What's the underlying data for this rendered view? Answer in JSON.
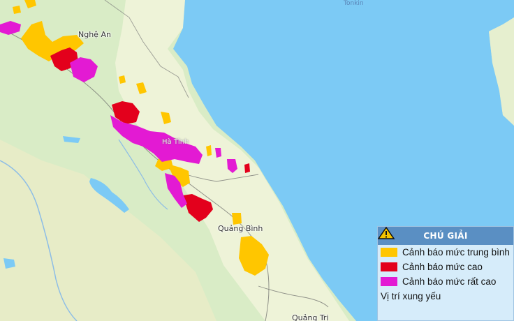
{
  "map": {
    "colors": {
      "sea": "#7ccaf5",
      "land": "#d9ecc6",
      "medium": "#ffc600",
      "high": "#e3001c",
      "very_high": "#e31ad3"
    },
    "places": {
      "nghe_an": "Nghệ An",
      "ha_tinh": "Hà Tĩnh",
      "quang_binh": "Quảng Bình",
      "quang_tri": "Quảng Trị",
      "tonkin": "Tonkin"
    }
  },
  "legend": {
    "title": "CHÚ GIẢI",
    "items": [
      {
        "label": "Cảnh báo mức trung bình",
        "color": "#ffc600"
      },
      {
        "label": "Cảnh báo mức cao",
        "color": "#e3001c"
      },
      {
        "label": "Cảnh báo mức rất cao",
        "color": "#e31ad3"
      }
    ],
    "vulnerable_label": "Vị trí xung yếu",
    "vulnerable_icon": "warning-triangle-icon"
  }
}
